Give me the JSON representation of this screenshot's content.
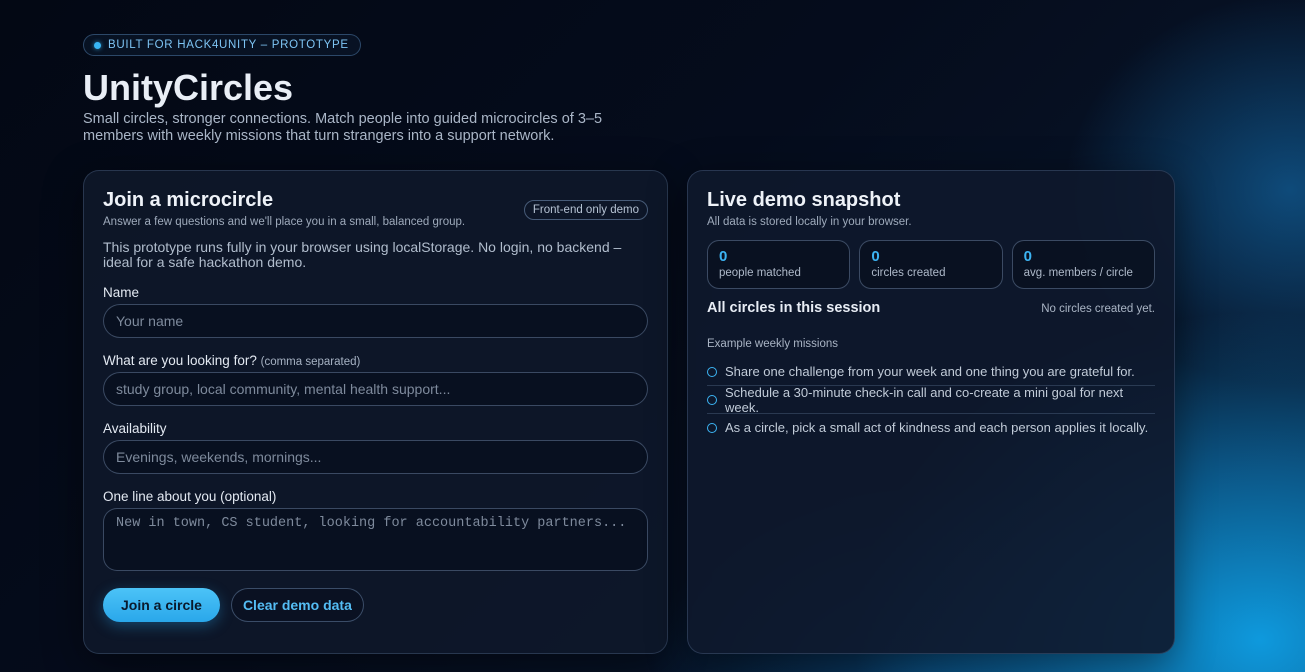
{
  "hero": {
    "badge": "BUILT FOR HACK4UNITY – PROTOTYPE",
    "title": "UnityCircles",
    "subtitle": "Small circles, stronger connections. Match people into guided microcircles of 3–5 members with weekly missions that turn strangers into a support network."
  },
  "join_panel": {
    "title": "Join a microcircle",
    "description": "Answer a few questions and we'll place you in a small, balanced group.",
    "pill": "Front-end only demo",
    "intro": "This prototype runs fully in your browser using localStorage. No login, no backend – ideal for a safe hackathon demo.",
    "name": {
      "label": "Name",
      "placeholder": "Your name",
      "value": ""
    },
    "looking_for": {
      "label": "What are you looking for?",
      "hint": "(comma separated)",
      "placeholder": "study group, local community, mental health support...",
      "value": ""
    },
    "availability": {
      "label": "Availability",
      "placeholder": "Evenings, weekends, mornings...",
      "value": ""
    },
    "about": {
      "label": "One line about you (optional)",
      "placeholder": "New in town, CS student, looking for accountability partners...",
      "value": ""
    },
    "join_button": "Join a circle",
    "clear_button": "Clear demo data"
  },
  "snapshot_panel": {
    "title": "Live demo snapshot",
    "description": "All data is stored locally in your browser.",
    "stats": [
      {
        "value": "0",
        "label": "people matched"
      },
      {
        "value": "0",
        "label": "circles created"
      },
      {
        "value": "0",
        "label": "avg. members / circle"
      }
    ],
    "circles_title": "All circles in this session",
    "circles_empty": "No circles created yet.",
    "missions_title": "Example weekly missions",
    "missions": [
      "Share one challenge from your week and one thing you are grateful for.",
      "Schedule a 30-minute check-in call and co-create a mini goal for next week.",
      "As a circle, pick a small act of kindness and each person applies it locally."
    ]
  },
  "colors": {
    "accent": "#38b6f5",
    "background": "#050c1c"
  }
}
